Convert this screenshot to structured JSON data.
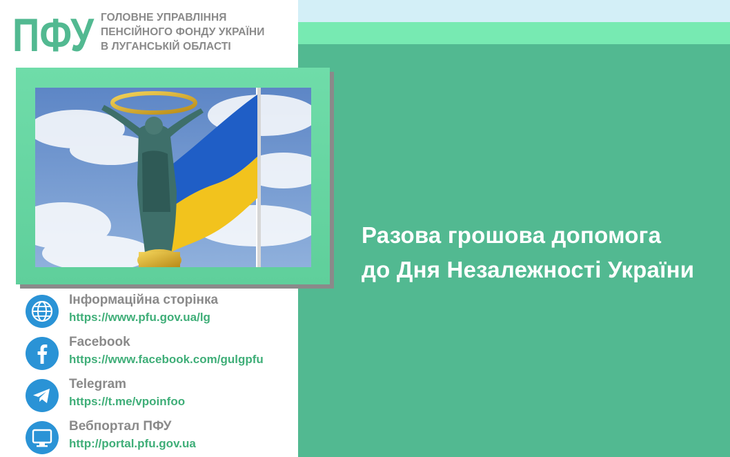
{
  "logo": {
    "mark": "ПФУ",
    "org_lines": [
      "ГОЛОВНЕ УПРАВЛІННЯ",
      "ПЕНСІЙНОГО ФОНДУ УКРАЇНИ",
      "В ЛУГАНСЬКІЙ ОБЛАСТІ"
    ]
  },
  "headline": {
    "line1": "Разова грошова допомога",
    "line2": "до Дня Незалежності України"
  },
  "contacts": [
    {
      "title": "Інформаційна сторінка",
      "url": "https://www.pfu.gov.ua/lg",
      "icon": "globe-icon"
    },
    {
      "title": "Facebook",
      "url": "https://www.facebook.com/gulgpfu",
      "icon": "facebook-icon"
    },
    {
      "title": "Telegram",
      "url": "https://t.me/vpoinfoo",
      "icon": "telegram-icon"
    },
    {
      "title": "Вебпортал ПФУ",
      "url": "http://portal.pfu.gov.ua",
      "icon": "monitor-icon"
    }
  ],
  "colors": {
    "panel_green": "#52b991",
    "mint_band": "#77eab2",
    "sky_band": "#d3eff7",
    "icon_blue": "#2a93d6",
    "link_green": "#3fae78",
    "text_gray": "#8a8a8a"
  }
}
